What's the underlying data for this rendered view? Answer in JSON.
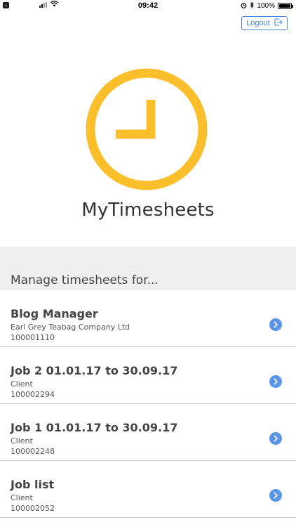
{
  "status_bar": {
    "time": "09:42",
    "battery": "100%",
    "icons": [
      "back-to-app-icon",
      "signal-icon",
      "wifi-icon",
      "alarm-icon",
      "bluetooth-icon",
      "battery-icon"
    ]
  },
  "header": {
    "logout_label": "Logout",
    "logout_icon": "logout-icon"
  },
  "app": {
    "logo_icon": "clock-icon",
    "title": "MyTimesheets",
    "accent_color": "#FBBF2C",
    "link_color": "#4A86D8"
  },
  "section": {
    "label": "Manage timesheets for..."
  },
  "jobs": [
    {
      "title": "Blog Manager",
      "client": "Earl Grey Teabag Company Ltd",
      "number": "100001110"
    },
    {
      "title": "Job 2 01.01.17 to 30.09.17",
      "client": "Client",
      "number": "100002294"
    },
    {
      "title": "Job 1 01.01.17 to 30.09.17",
      "client": "Client",
      "number": "100002248"
    },
    {
      "title": "Job list",
      "client": "Client",
      "number": "100002052"
    }
  ]
}
